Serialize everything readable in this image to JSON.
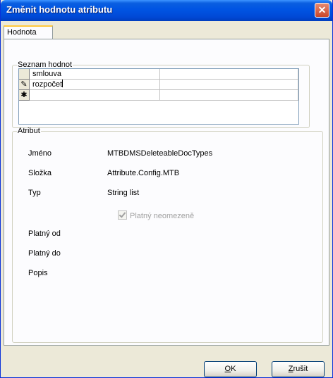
{
  "window": {
    "title": "Změnit hodnotu atributu",
    "close_glyph": "✕"
  },
  "tabs": [
    {
      "label": "Hodnota",
      "active": true
    }
  ],
  "values_group": {
    "legend": "Seznam hodnot",
    "rows": [
      {
        "indicator": "",
        "value": "smlouva",
        "extra": ""
      },
      {
        "indicator": "✎",
        "value": "rozpočet",
        "extra": ""
      },
      {
        "indicator": "✱",
        "value": "",
        "extra": ""
      }
    ]
  },
  "attribute_group": {
    "legend": "Atribut",
    "fields": {
      "name_label": "Jméno",
      "name_value": "MTBDMSDeleteableDocTypes",
      "folder_label": "Složka",
      "folder_value": "Attribute.Config.MTB",
      "type_label": "Typ",
      "type_value": "String list",
      "unlimited_label": "Platný neomezeně",
      "unlimited_checked": true,
      "unlimited_enabled": false,
      "valid_from_label": "Platný od",
      "valid_from_value": "",
      "valid_to_label": "Platný do",
      "valid_to_value": "",
      "description_label": "Popis",
      "description_value": ""
    }
  },
  "buttons": {
    "ok_accel": "O",
    "ok_rest": "K",
    "cancel_accel": "Z",
    "cancel_rest": "rušit"
  },
  "colors": {
    "title_bar": "#0054e3",
    "close_button": "#c9462a",
    "tab_highlight": "#ffc83c",
    "dialog_bg": "#ece9d8"
  }
}
